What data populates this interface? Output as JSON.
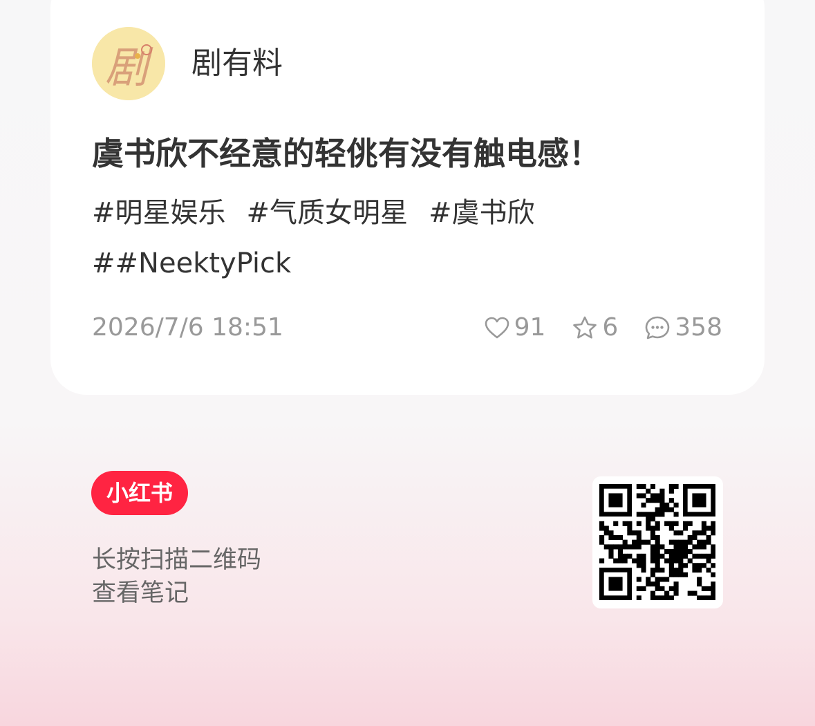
{
  "author": {
    "name": "剧有料",
    "avatar_text": "剧"
  },
  "post": {
    "title": "虞书欣不经意的轻佻有没有触电感！",
    "tags_row1": [
      "#明星娱乐",
      "#气质女明星",
      "#虞书欣"
    ],
    "tags_row2": [
      "##NeektyPick"
    ],
    "time": "2026/7/6 18:51"
  },
  "stats": {
    "likes": "91",
    "collects": "6",
    "comments": "358"
  },
  "footer": {
    "brand": "小红书",
    "hint_line1": "长按扫描二维码",
    "hint_line2": "查看笔记"
  },
  "colors": {
    "brand_red": "#ff2442",
    "text_dark": "#333333",
    "text_muted": "#999999"
  },
  "icons": {
    "like": "heart-icon",
    "collect": "star-icon",
    "comment": "comment-icon"
  }
}
